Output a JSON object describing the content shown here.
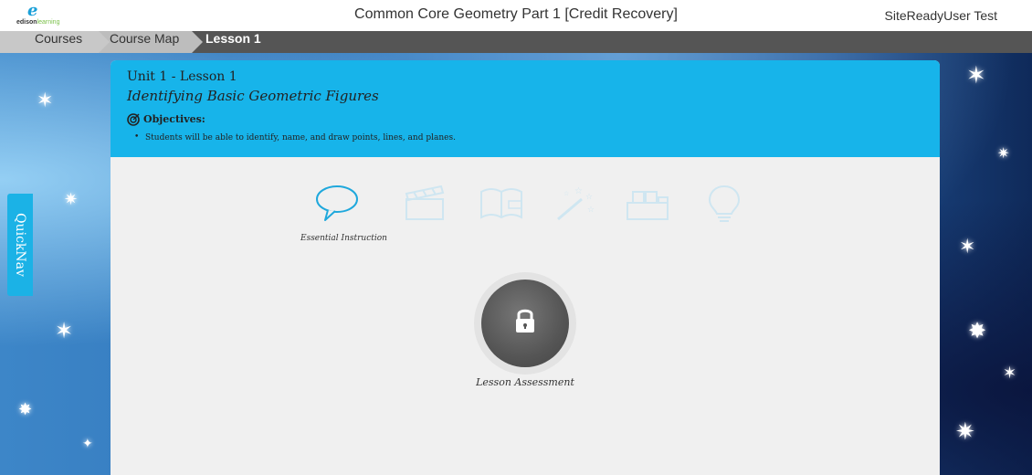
{
  "header": {
    "logo_mark": "e",
    "logo_text_bold": "edison",
    "logo_text_accent": "learning",
    "title": "Common Core Geometry Part 1 [Credit Recovery]",
    "user": "SiteReadyUser Test"
  },
  "breadcrumb": [
    "Courses",
    "Course Map",
    "Lesson 1"
  ],
  "quicknav": {
    "label": "QuickNav"
  },
  "lesson": {
    "unit": "Unit 1 - Lesson 1",
    "title": "Identifying Basic Geometric Figures",
    "objectives_label": "Objectives:",
    "objectives": [
      "Students will be able to identify, name, and draw points, lines, and planes."
    ]
  },
  "activities": {
    "items": [
      {
        "icon": "speech-bubble-icon",
        "active": true,
        "label": "Essential Instruction"
      },
      {
        "icon": "clapperboard-icon",
        "active": false
      },
      {
        "icon": "open-book-icon",
        "active": false
      },
      {
        "icon": "magic-wand-icon",
        "active": false
      },
      {
        "icon": "building-blocks-icon",
        "active": false
      },
      {
        "icon": "lightbulb-icon",
        "active": false
      }
    ]
  },
  "assessment": {
    "label": "Lesson Assessment",
    "icon": "lock-icon"
  },
  "colors": {
    "accent": "#17b4ea",
    "active_icon": "#1fa8dc",
    "inactive_icon": "#cfe6f1",
    "breadcrumb_bg": "#555555"
  }
}
